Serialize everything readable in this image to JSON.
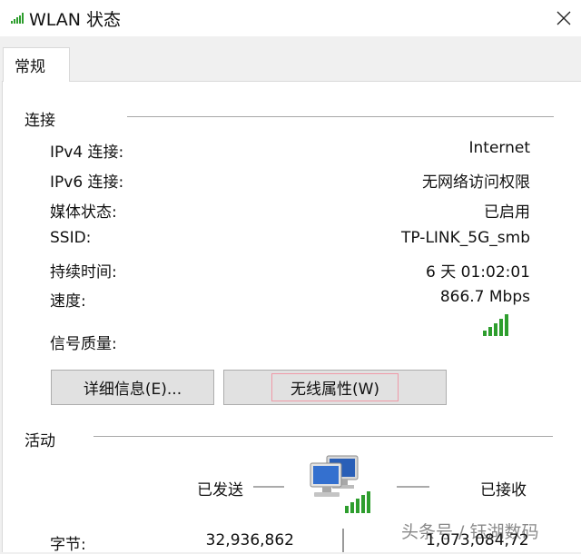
{
  "window": {
    "title": "WLAN 状态",
    "close_icon": "close-icon"
  },
  "tabs": [
    {
      "label": "常规"
    }
  ],
  "connection": {
    "section_title": "连接",
    "rows": [
      {
        "label": "IPv4 连接:",
        "value": "Internet"
      },
      {
        "label": "IPv6 连接:",
        "value": "无网络访问权限"
      },
      {
        "label": "媒体状态:",
        "value": "已启用"
      },
      {
        "label": "SSID:",
        "value": "TP-LINK_5G_smb"
      },
      {
        "label": "持续时间:",
        "value": "6 天 01:02:01"
      },
      {
        "label": "速度:",
        "value": "866.7 Mbps"
      }
    ],
    "signal_label": "信号质量:",
    "signal_bars": 5,
    "signal_color": "#2e9e2e"
  },
  "buttons": {
    "details": "详细信息(E)...",
    "wireless_properties": "无线属性(W)"
  },
  "activity": {
    "section_title": "活动",
    "sent_label": "已发送",
    "received_label": "已接收",
    "bytes_label": "字节:",
    "bytes_sent": "32,936,862",
    "bytes_received": "1,073,084,72"
  },
  "watermark": "头条号 / 钰湖数码"
}
